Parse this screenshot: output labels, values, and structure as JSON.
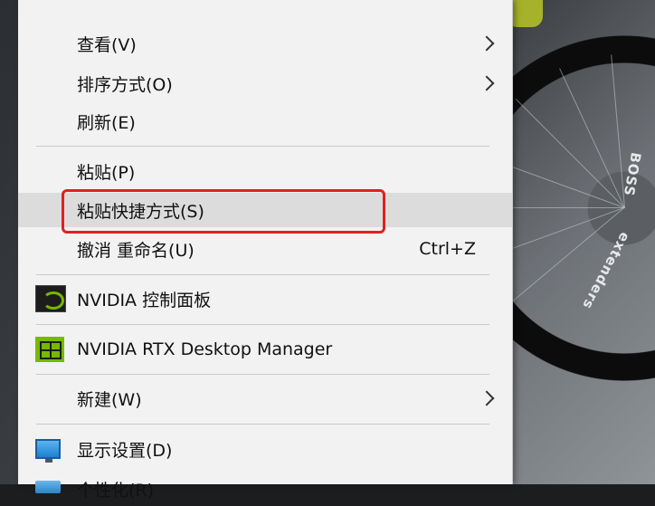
{
  "menu": {
    "items": [
      {
        "label": "查看(V)",
        "has_submenu": true
      },
      {
        "label": "排序方式(O)",
        "has_submenu": true
      },
      {
        "label": "刷新(E)",
        "has_submenu": false
      },
      {
        "label": "粘贴(P)",
        "has_submenu": false
      },
      {
        "label": "粘贴快捷方式(S)",
        "has_submenu": false,
        "highlighted": true
      },
      {
        "label": "撤消 重命名(U)",
        "shortcut": "Ctrl+Z"
      },
      {
        "label": "NVIDIA 控制面板",
        "icon": "nvidia-icon"
      },
      {
        "label": "NVIDIA RTX Desktop Manager",
        "icon": "nvidia-rtx-icon"
      },
      {
        "label": "新建(W)",
        "has_submenu": true
      },
      {
        "label": "显示设置(D)",
        "icon": "display-settings-icon"
      },
      {
        "label": "个性化(R)",
        "icon": "personalize-icon"
      }
    ]
  },
  "wallpaper": {
    "tire_text_1": "BOSS",
    "tire_text_2": "extenders"
  },
  "colors": {
    "menu_bg": "#f2f2f2",
    "hover_bg": "#dcdcdc",
    "highlight_border": "#e02020",
    "nvidia_green": "#76b900"
  }
}
